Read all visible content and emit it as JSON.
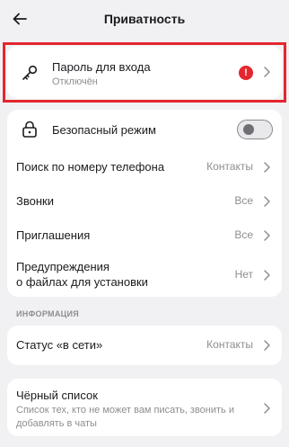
{
  "header": {
    "title": "Приватность"
  },
  "password": {
    "title": "Пароль для входа",
    "subtitle": "Отключён",
    "badge": "!"
  },
  "safe_mode": {
    "title": "Безопасный режим",
    "enabled": false
  },
  "phone_search": {
    "title": "Поиск по номеру телефона",
    "value": "Контакты"
  },
  "calls": {
    "title": "Звонки",
    "value": "Все"
  },
  "invitations": {
    "title": "Приглашения",
    "value": "Все"
  },
  "warnings": {
    "title_line1": "Предупреждения",
    "title_line2": "о файлах для установки",
    "value": "Нет"
  },
  "info_section": {
    "label": "ИНФОРМАЦИЯ"
  },
  "online_status": {
    "title": "Статус «в сети»",
    "value": "Контакты"
  },
  "blacklist": {
    "title": "Чёрный список",
    "subtitle_line1": "Список тех, кто не может вам писать, звонить и",
    "subtitle_line2": "добавлять в чаты"
  },
  "icons": [
    "back-arrow-icon",
    "key-icon",
    "lock-icon",
    "chevron-right-icon",
    "alert-icon"
  ],
  "colors": {
    "background": "#f1f1f3",
    "card": "#ffffff",
    "highlight": "#e5262e",
    "secondary_text": "#8e8e93"
  }
}
